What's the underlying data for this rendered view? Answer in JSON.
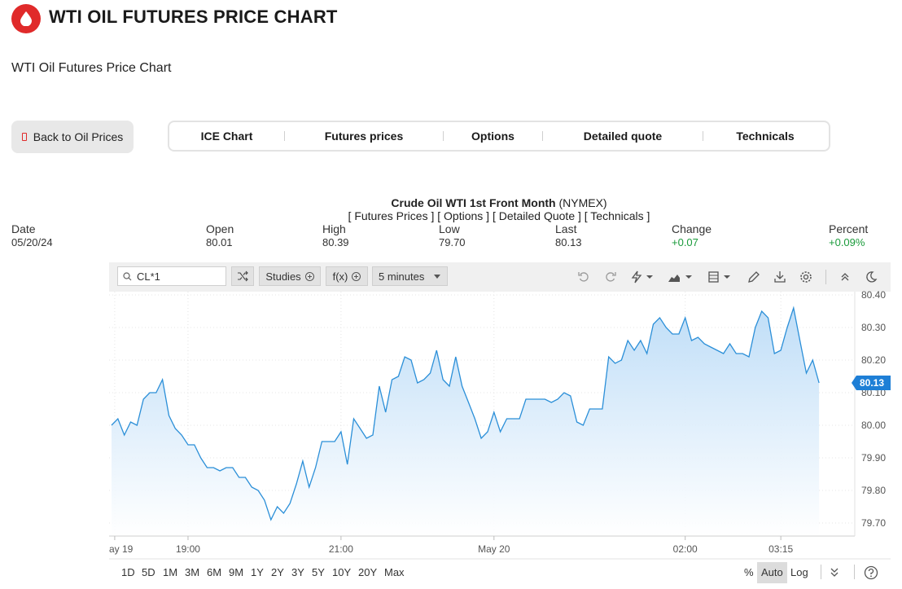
{
  "header": {
    "title": "WTI OIL FUTURES PRICE CHART",
    "subtitle": "WTI Oil Futures Price Chart",
    "back_button": "Back to Oil Prices"
  },
  "tabs": [
    "ICE Chart",
    "Futures prices",
    "Options",
    "Detailed quote",
    "Technicals"
  ],
  "quote": {
    "name": "Crude Oil WTI 1st Front Month",
    "exchange": "(NYMEX)",
    "links": "[ Futures Prices ] [ Options ] [ Detailed Quote ] [ Technicals ]",
    "labels": {
      "date": "Date",
      "open": "Open",
      "high": "High",
      "low": "Low",
      "last": "Last",
      "change": "Change",
      "percent": "Percent"
    },
    "values": {
      "date": "05/20/24",
      "open": "80.01",
      "high": "80.39",
      "low": "79.70",
      "last": "80.13",
      "change": "+0.07",
      "percent": "+0.09%"
    }
  },
  "toolbar": {
    "symbol": "CL*1",
    "studies": "Studies",
    "fx": "f(x)",
    "interval": "5 minutes"
  },
  "chart_data": {
    "type": "area",
    "title": "",
    "xlabel": "",
    "ylabel": "",
    "ylim": [
      79.66,
      80.41
    ],
    "y_ticks": [
      "80.40",
      "80.30",
      "80.20",
      "80.10",
      "80.00",
      "79.90",
      "79.80",
      "79.70"
    ],
    "x_ticks": [
      {
        "label": "ay 19",
        "x": 0.5
      },
      {
        "label": "19:00",
        "x": 12
      },
      {
        "label": "21:00",
        "x": 36
      },
      {
        "label": "May 20",
        "x": 60
      },
      {
        "label": "02:00",
        "x": 90
      },
      {
        "label": "03:15",
        "x": 105
      }
    ],
    "last_value": "80.13",
    "color": "#2b8fd8",
    "series": [
      {
        "values": [
          80.0,
          80.02,
          79.97,
          80.01,
          80.0,
          80.08,
          80.1,
          80.1,
          80.14,
          80.03,
          79.99,
          79.97,
          79.94,
          79.94,
          79.9,
          79.87,
          79.87,
          79.86,
          79.87,
          79.87,
          79.84,
          79.84,
          79.81,
          79.8,
          79.77,
          79.71,
          79.75,
          79.73,
          79.76,
          79.82,
          79.89,
          79.81,
          79.87,
          79.95,
          79.95,
          79.95,
          79.98,
          79.88,
          80.02,
          79.99,
          79.96,
          79.97,
          80.12,
          80.04,
          80.14,
          80.15,
          80.21,
          80.2,
          80.13,
          80.14,
          80.16,
          80.23,
          80.14,
          80.12,
          80.21,
          80.12,
          80.07,
          80.02,
          79.96,
          79.98,
          80.04,
          79.98,
          80.02,
          80.02,
          80.02,
          80.08,
          80.08,
          80.08,
          80.08,
          80.07,
          80.08,
          80.1,
          80.09,
          80.01,
          80.0,
          80.05,
          80.05,
          80.05,
          80.21,
          80.19,
          80.2,
          80.26,
          80.23,
          80.26,
          80.22,
          80.31,
          80.33,
          80.3,
          80.28,
          80.28,
          80.33,
          80.26,
          80.27,
          80.25,
          80.24,
          80.23,
          80.22,
          80.25,
          80.22,
          80.22,
          80.21,
          80.3,
          80.35,
          80.33,
          80.22,
          80.23,
          80.3,
          80.36,
          80.26,
          80.16,
          80.2,
          80.13
        ]
      }
    ]
  },
  "ranges": [
    "1D",
    "5D",
    "1M",
    "3M",
    "6M",
    "9M",
    "1Y",
    "2Y",
    "3Y",
    "5Y",
    "10Y",
    "20Y",
    "Max"
  ],
  "scale": {
    "percent": "%",
    "auto": "Auto",
    "log": "Log"
  }
}
